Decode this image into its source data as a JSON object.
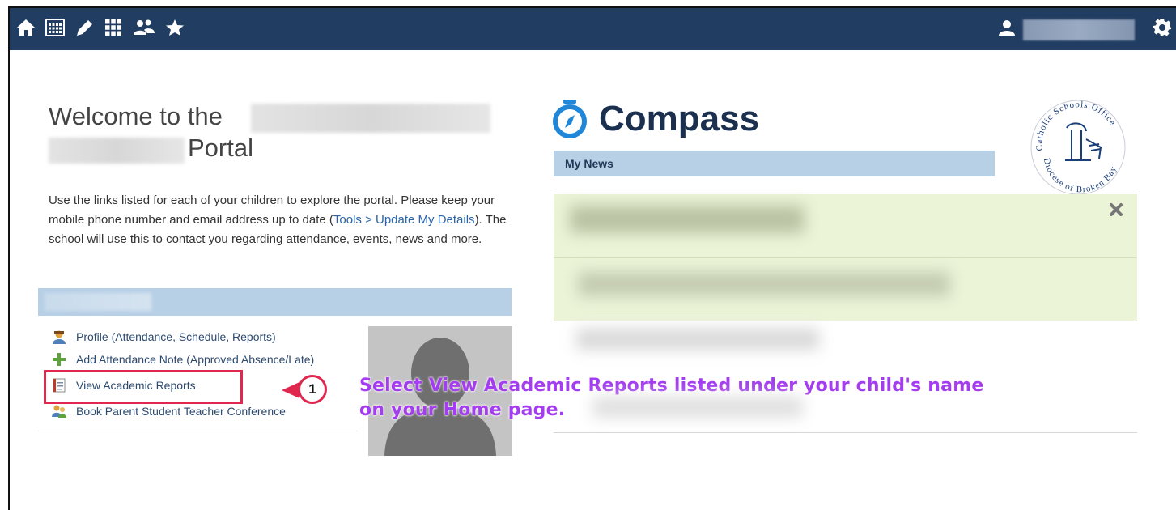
{
  "navbar": {
    "icons": [
      "home-icon",
      "calendar-icon",
      "pencil-icon",
      "grid-icon",
      "people-icon",
      "star-icon"
    ],
    "user_icon": "user-icon",
    "settings_icon": "gear-icon",
    "bg_color": "#213d62"
  },
  "welcome": {
    "title": "Welcome to the",
    "portal_word": "Portal",
    "intro_before_link": "Use the links listed for each of your children to explore the portal. Please keep your mobile phone number and email address up to date (",
    "intro_link": "Tools > Update My Details",
    "intro_after_link": "). The school will use this to contact you regarding attendance, events, news and more."
  },
  "child": {
    "header_color": "#b8d0e6",
    "links": [
      {
        "label": "Profile (Attendance, Schedule, Reports)",
        "icon": "profile-icon"
      },
      {
        "label": "Add Attendance Note (Approved Absence/Late)",
        "icon": "plus-icon"
      },
      {
        "label": "View Academic Reports",
        "icon": "report-icon"
      },
      {
        "label": "Book Parent Student Teacher Conference",
        "icon": "conference-icon"
      }
    ]
  },
  "annotation": {
    "step_number": "1",
    "text_line1": "Select View Academic Reports listed under your child's name",
    "text_line2": "on your Home page.",
    "highlight_color": "#e0284f",
    "text_color": "#a43cf0"
  },
  "compass": {
    "brand": "Compass",
    "news_header": "My News"
  },
  "school_logo": {
    "arc_top": "Catholic Schools Office",
    "arc_bottom": "Diocese of Broken Bay"
  }
}
